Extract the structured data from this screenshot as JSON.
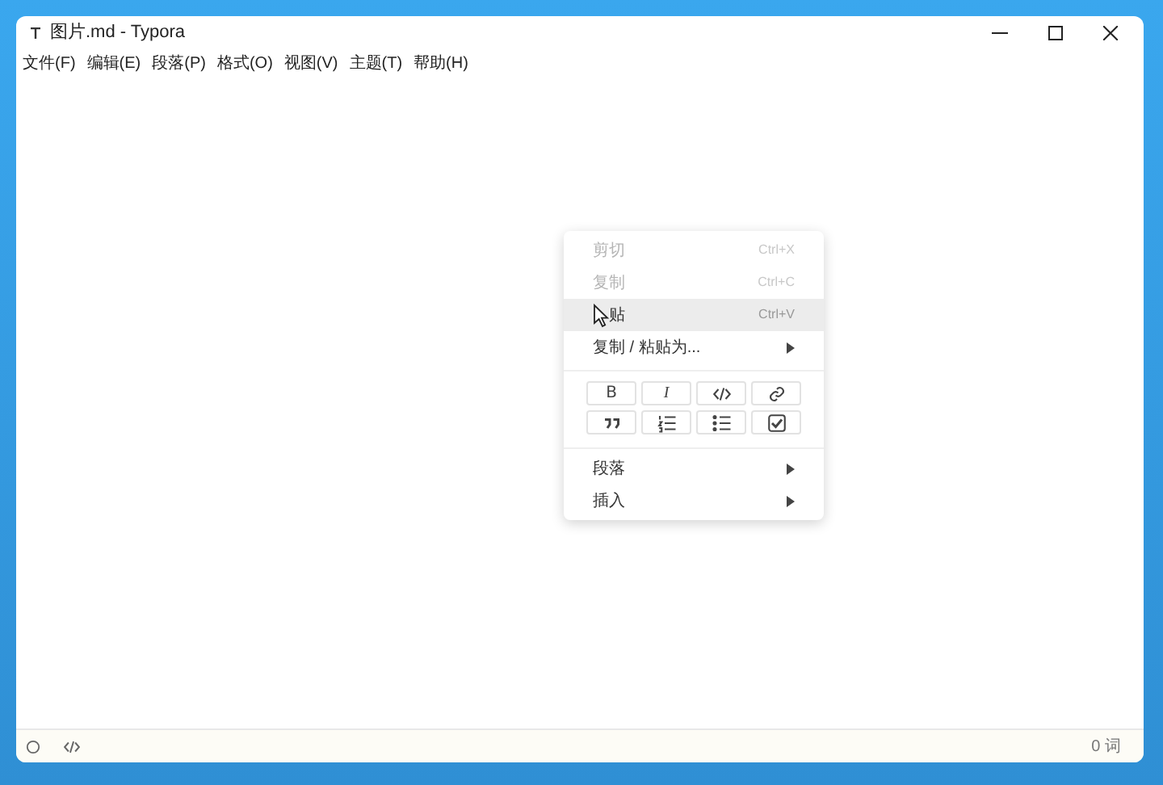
{
  "window": {
    "title": "图片.md - Typora"
  },
  "menu_bar": [
    "文件(F)",
    "编辑(E)",
    "段落(P)",
    "格式(O)",
    "视图(V)",
    "主题(T)",
    "帮助(H)"
  ],
  "context_menu": {
    "items": [
      {
        "label": "剪切",
        "shortcut": "Ctrl+X",
        "disabled": true,
        "selected": false
      },
      {
        "label": "复制",
        "shortcut": "Ctrl+C",
        "disabled": true,
        "selected": false
      },
      {
        "label": "贴",
        "shortcut": "Ctrl+V",
        "disabled": false,
        "selected": true
      },
      {
        "label": "复制 / 粘贴为...",
        "disabled": false,
        "selected": false,
        "submenu": true
      }
    ],
    "format_buttons": [
      {
        "kind": "bold",
        "label": "B"
      },
      {
        "kind": "italic",
        "label": "I"
      },
      {
        "kind": "code"
      },
      {
        "kind": "link"
      },
      {
        "kind": "quote"
      },
      {
        "kind": "ordered-list"
      },
      {
        "kind": "bullet-list"
      },
      {
        "kind": "task"
      }
    ],
    "bottom_items": [
      {
        "label": "段落",
        "submenu": true
      },
      {
        "label": "插入",
        "submenu": true
      }
    ]
  },
  "status_bar": {
    "word_count": "0 词"
  }
}
